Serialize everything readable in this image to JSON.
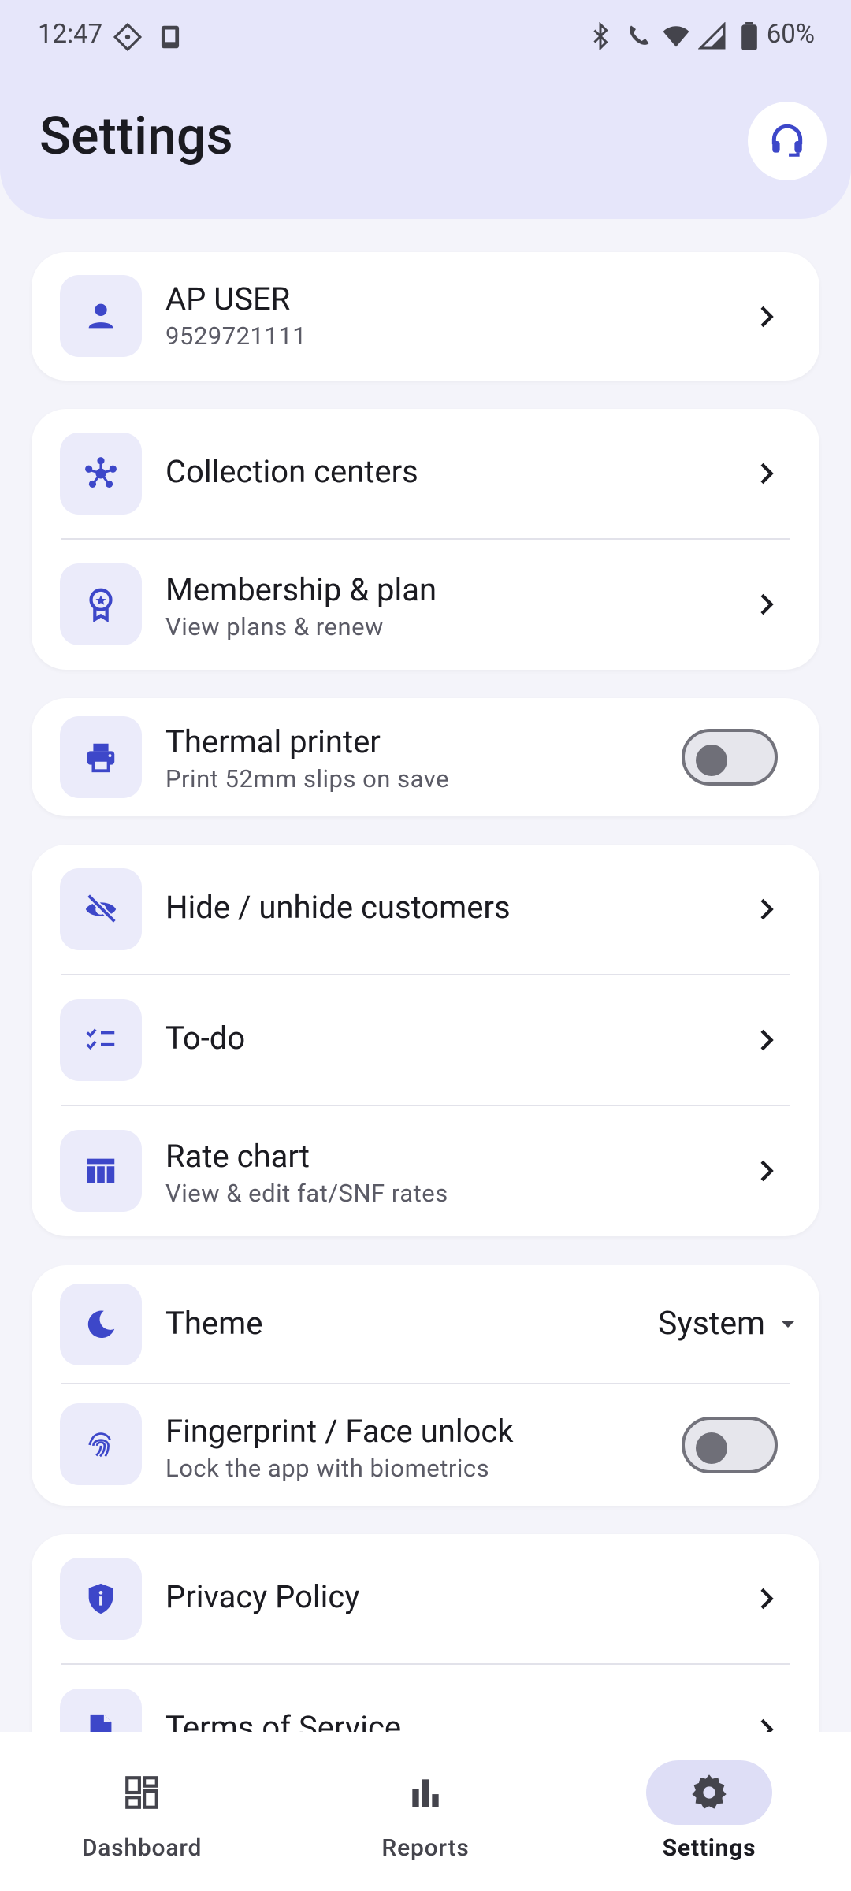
{
  "status_bar": {
    "time": "12:47",
    "battery": "60%"
  },
  "header": {
    "title": "Settings"
  },
  "profile": {
    "name": "AP USER",
    "phone": "9529721111"
  },
  "groups": {
    "collection_centers": {
      "title": "Collection centers"
    },
    "membership": {
      "title": "Membership & plan",
      "subtitle": "View plans & renew"
    },
    "thermal_printer": {
      "title": "Thermal printer",
      "subtitle": "Print 52mm slips on save",
      "enabled": false
    },
    "hide_customers": {
      "title": "Hide / unhide customers"
    },
    "todo": {
      "title": "To-do"
    },
    "rate_chart": {
      "title": "Rate chart",
      "subtitle": "View & edit fat/SNF rates"
    },
    "theme": {
      "title": "Theme",
      "value": "System"
    },
    "biometric": {
      "title": "Fingerprint / Face unlock",
      "subtitle": "Lock the app with biometrics",
      "enabled": false
    },
    "privacy": {
      "title": "Privacy Policy"
    },
    "terms": {
      "title": "Terms of Service"
    }
  },
  "bottom_nav": {
    "items": [
      {
        "label": "Dashboard",
        "icon": "dashboard-icon",
        "active": false
      },
      {
        "label": "Reports",
        "icon": "bar-chart-icon",
        "active": false
      },
      {
        "label": "Settings",
        "icon": "gear-icon",
        "active": true
      }
    ]
  },
  "colors": {
    "accent": "#3d47c9",
    "tile_bg": "#ebebfa",
    "header_bg": "#e6e6fa"
  }
}
